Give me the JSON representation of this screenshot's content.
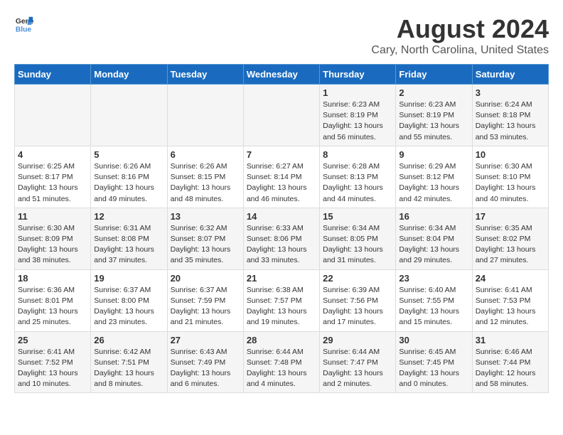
{
  "header": {
    "logo_line1": "General",
    "logo_line2": "Blue",
    "main_title": "August 2024",
    "subtitle": "Cary, North Carolina, United States"
  },
  "weekdays": [
    "Sunday",
    "Monday",
    "Tuesday",
    "Wednesday",
    "Thursday",
    "Friday",
    "Saturday"
  ],
  "weeks": [
    [
      {
        "day": "",
        "sunrise": "",
        "sunset": "",
        "daylight": ""
      },
      {
        "day": "",
        "sunrise": "",
        "sunset": "",
        "daylight": ""
      },
      {
        "day": "",
        "sunrise": "",
        "sunset": "",
        "daylight": ""
      },
      {
        "day": "",
        "sunrise": "",
        "sunset": "",
        "daylight": ""
      },
      {
        "day": "1",
        "sunrise": "Sunrise: 6:23 AM",
        "sunset": "Sunset: 8:19 PM",
        "daylight": "Daylight: 13 hours and 56 minutes."
      },
      {
        "day": "2",
        "sunrise": "Sunrise: 6:23 AM",
        "sunset": "Sunset: 8:19 PM",
        "daylight": "Daylight: 13 hours and 55 minutes."
      },
      {
        "day": "3",
        "sunrise": "Sunrise: 6:24 AM",
        "sunset": "Sunset: 8:18 PM",
        "daylight": "Daylight: 13 hours and 53 minutes."
      }
    ],
    [
      {
        "day": "4",
        "sunrise": "Sunrise: 6:25 AM",
        "sunset": "Sunset: 8:17 PM",
        "daylight": "Daylight: 13 hours and 51 minutes."
      },
      {
        "day": "5",
        "sunrise": "Sunrise: 6:26 AM",
        "sunset": "Sunset: 8:16 PM",
        "daylight": "Daylight: 13 hours and 49 minutes."
      },
      {
        "day": "6",
        "sunrise": "Sunrise: 6:26 AM",
        "sunset": "Sunset: 8:15 PM",
        "daylight": "Daylight: 13 hours and 48 minutes."
      },
      {
        "day": "7",
        "sunrise": "Sunrise: 6:27 AM",
        "sunset": "Sunset: 8:14 PM",
        "daylight": "Daylight: 13 hours and 46 minutes."
      },
      {
        "day": "8",
        "sunrise": "Sunrise: 6:28 AM",
        "sunset": "Sunset: 8:13 PM",
        "daylight": "Daylight: 13 hours and 44 minutes."
      },
      {
        "day": "9",
        "sunrise": "Sunrise: 6:29 AM",
        "sunset": "Sunset: 8:12 PM",
        "daylight": "Daylight: 13 hours and 42 minutes."
      },
      {
        "day": "10",
        "sunrise": "Sunrise: 6:30 AM",
        "sunset": "Sunset: 8:10 PM",
        "daylight": "Daylight: 13 hours and 40 minutes."
      }
    ],
    [
      {
        "day": "11",
        "sunrise": "Sunrise: 6:30 AM",
        "sunset": "Sunset: 8:09 PM",
        "daylight": "Daylight: 13 hours and 38 minutes."
      },
      {
        "day": "12",
        "sunrise": "Sunrise: 6:31 AM",
        "sunset": "Sunset: 8:08 PM",
        "daylight": "Daylight: 13 hours and 37 minutes."
      },
      {
        "day": "13",
        "sunrise": "Sunrise: 6:32 AM",
        "sunset": "Sunset: 8:07 PM",
        "daylight": "Daylight: 13 hours and 35 minutes."
      },
      {
        "day": "14",
        "sunrise": "Sunrise: 6:33 AM",
        "sunset": "Sunset: 8:06 PM",
        "daylight": "Daylight: 13 hours and 33 minutes."
      },
      {
        "day": "15",
        "sunrise": "Sunrise: 6:34 AM",
        "sunset": "Sunset: 8:05 PM",
        "daylight": "Daylight: 13 hours and 31 minutes."
      },
      {
        "day": "16",
        "sunrise": "Sunrise: 6:34 AM",
        "sunset": "Sunset: 8:04 PM",
        "daylight": "Daylight: 13 hours and 29 minutes."
      },
      {
        "day": "17",
        "sunrise": "Sunrise: 6:35 AM",
        "sunset": "Sunset: 8:02 PM",
        "daylight": "Daylight: 13 hours and 27 minutes."
      }
    ],
    [
      {
        "day": "18",
        "sunrise": "Sunrise: 6:36 AM",
        "sunset": "Sunset: 8:01 PM",
        "daylight": "Daylight: 13 hours and 25 minutes."
      },
      {
        "day": "19",
        "sunrise": "Sunrise: 6:37 AM",
        "sunset": "Sunset: 8:00 PM",
        "daylight": "Daylight: 13 hours and 23 minutes."
      },
      {
        "day": "20",
        "sunrise": "Sunrise: 6:37 AM",
        "sunset": "Sunset: 7:59 PM",
        "daylight": "Daylight: 13 hours and 21 minutes."
      },
      {
        "day": "21",
        "sunrise": "Sunrise: 6:38 AM",
        "sunset": "Sunset: 7:57 PM",
        "daylight": "Daylight: 13 hours and 19 minutes."
      },
      {
        "day": "22",
        "sunrise": "Sunrise: 6:39 AM",
        "sunset": "Sunset: 7:56 PM",
        "daylight": "Daylight: 13 hours and 17 minutes."
      },
      {
        "day": "23",
        "sunrise": "Sunrise: 6:40 AM",
        "sunset": "Sunset: 7:55 PM",
        "daylight": "Daylight: 13 hours and 15 minutes."
      },
      {
        "day": "24",
        "sunrise": "Sunrise: 6:41 AM",
        "sunset": "Sunset: 7:53 PM",
        "daylight": "Daylight: 13 hours and 12 minutes."
      }
    ],
    [
      {
        "day": "25",
        "sunrise": "Sunrise: 6:41 AM",
        "sunset": "Sunset: 7:52 PM",
        "daylight": "Daylight: 13 hours and 10 minutes."
      },
      {
        "day": "26",
        "sunrise": "Sunrise: 6:42 AM",
        "sunset": "Sunset: 7:51 PM",
        "daylight": "Daylight: 13 hours and 8 minutes."
      },
      {
        "day": "27",
        "sunrise": "Sunrise: 6:43 AM",
        "sunset": "Sunset: 7:49 PM",
        "daylight": "Daylight: 13 hours and 6 minutes."
      },
      {
        "day": "28",
        "sunrise": "Sunrise: 6:44 AM",
        "sunset": "Sunset: 7:48 PM",
        "daylight": "Daylight: 13 hours and 4 minutes."
      },
      {
        "day": "29",
        "sunrise": "Sunrise: 6:44 AM",
        "sunset": "Sunset: 7:47 PM",
        "daylight": "Daylight: 13 hours and 2 minutes."
      },
      {
        "day": "30",
        "sunrise": "Sunrise: 6:45 AM",
        "sunset": "Sunset: 7:45 PM",
        "daylight": "Daylight: 13 hours and 0 minutes."
      },
      {
        "day": "31",
        "sunrise": "Sunrise: 6:46 AM",
        "sunset": "Sunset: 7:44 PM",
        "daylight": "Daylight: 12 hours and 58 minutes."
      }
    ]
  ]
}
